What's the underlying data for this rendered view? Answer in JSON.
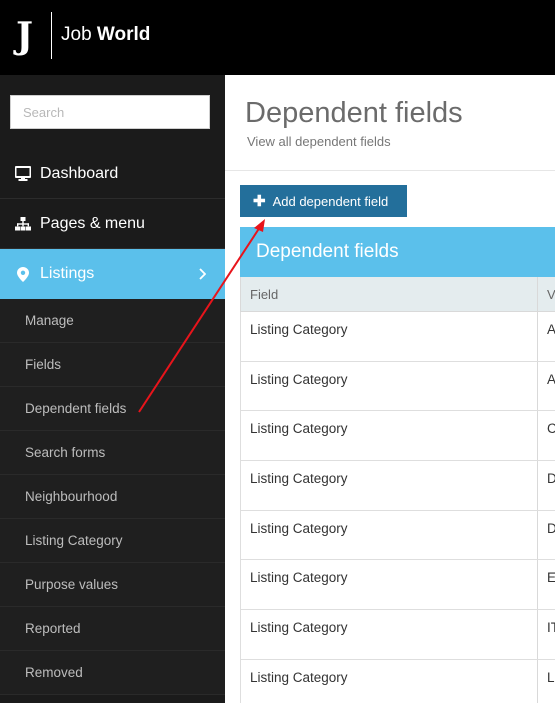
{
  "brand": {
    "logo_letter": "J",
    "name_light": "Job ",
    "name_bold": "World"
  },
  "sidebar": {
    "search_placeholder": "Search",
    "items": [
      {
        "label": "Dashboard",
        "icon": "monitor-icon"
      },
      {
        "label": "Pages & menu",
        "icon": "sitemap-icon"
      },
      {
        "label": "Listings",
        "icon": "map-marker-icon",
        "active": true
      }
    ],
    "subitems": [
      "Manage",
      "Fields",
      "Dependent fields",
      "Search forms",
      "Neighbourhood",
      "Listing Category",
      "Purpose values",
      "Reported",
      "Removed"
    ]
  },
  "main": {
    "title": "Dependent fields",
    "subtitle": "View all dependent fields",
    "add_button_label": "Add dependent field",
    "panel_title": "Dependent fields",
    "table": {
      "headers": [
        "Field",
        "V"
      ],
      "rows": [
        [
          "Listing Category",
          "A"
        ],
        [
          "Listing Category",
          "A"
        ],
        [
          "Listing Category",
          "C"
        ],
        [
          "Listing Category",
          "D"
        ],
        [
          "Listing Category",
          "D"
        ],
        [
          "Listing Category",
          "E"
        ],
        [
          "Listing Category",
          "IT"
        ],
        [
          "Listing Category",
          "L"
        ]
      ]
    }
  },
  "colors": {
    "accent": "#5bc0eb",
    "button": "#236f9b",
    "sidebar": "#1b1b1b",
    "topbar": "#000000",
    "annotation": "#e8141b"
  }
}
